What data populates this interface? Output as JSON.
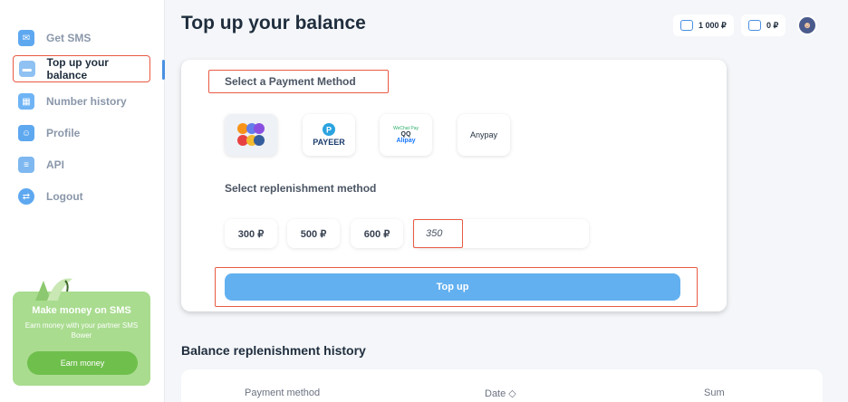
{
  "sidebar": {
    "items": [
      {
        "label": "Get SMS",
        "icon": "sms-icon",
        "color": "#5ea8f0"
      },
      {
        "label": "Top up your balance",
        "icon": "wallet-icon",
        "color": "#8fc1f3"
      },
      {
        "label": "Number history",
        "icon": "history-icon",
        "color": "#6fb4f5"
      },
      {
        "label": "Profile",
        "icon": "profile-icon",
        "color": "#5ea8f0"
      },
      {
        "label": "API",
        "icon": "api-icon",
        "color": "#7fb8f0"
      },
      {
        "label": "Logout",
        "icon": "logout-icon",
        "color": "#5ea8f0"
      }
    ],
    "promo": {
      "title": "Make money on SMS",
      "subtitle": "Earn money with your partner SMS Bower",
      "button": "Earn money"
    }
  },
  "header": {
    "title": "Top up your balance",
    "balance": "1 000 ₽",
    "bonus": "0 ₽"
  },
  "payment": {
    "select_label": "Select a Payment Method",
    "methods": [
      {
        "name": "crypto",
        "selected": true
      },
      {
        "name": "PAYEER",
        "label": "PAYEER"
      },
      {
        "name": "wechat-qq-alipay",
        "lines": [
          "WeChat Pay",
          "QQ",
          "Alipay"
        ]
      },
      {
        "name": "anypay",
        "label": "Anypay"
      }
    ],
    "replenish_label": "Select replenishment method",
    "amounts": [
      "300 ₽",
      "500 ₽",
      "600 ₽"
    ],
    "custom_amount": "350",
    "submit": "Top up"
  },
  "history": {
    "title": "Balance replenishment history",
    "columns": [
      "Payment method",
      "Date ◇",
      "Sum"
    ]
  },
  "colors": {
    "accent": "#62b0f0",
    "highlight": "#e85a44",
    "promo": "#a9dc8f"
  }
}
